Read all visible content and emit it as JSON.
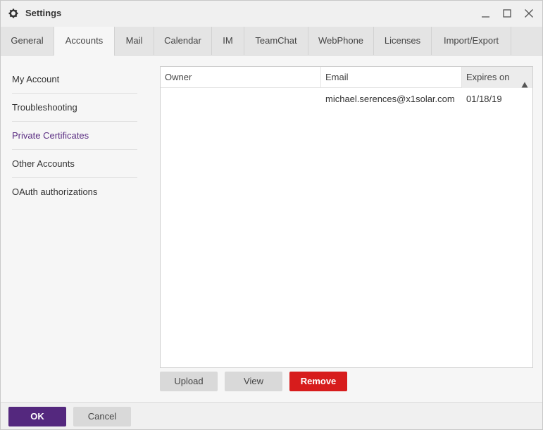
{
  "window": {
    "title": "Settings",
    "icons": {
      "app": "gear-icon",
      "minimize": "minimize-icon",
      "maximize": "maximize-icon",
      "close": "close-icon"
    }
  },
  "tabs": [
    {
      "label": "General"
    },
    {
      "label": "Accounts",
      "active": true
    },
    {
      "label": "Mail"
    },
    {
      "label": "Calendar"
    },
    {
      "label": "IM"
    },
    {
      "label": "TeamChat"
    },
    {
      "label": "WebPhone"
    },
    {
      "label": "Licenses"
    },
    {
      "label": "Import/Export"
    }
  ],
  "sidebar": {
    "items": [
      {
        "label": "My Account"
      },
      {
        "label": "Troubleshooting"
      },
      {
        "label": "Private Certificates",
        "active": true
      },
      {
        "label": "Other Accounts"
      },
      {
        "label": "OAuth authorizations"
      }
    ]
  },
  "grid": {
    "columns": [
      {
        "label": "Owner"
      },
      {
        "label": "Email"
      },
      {
        "label": "Expires on",
        "sorted": "ascending"
      }
    ],
    "rows": [
      {
        "owner": "",
        "email": "michael.serences@x1solar.com",
        "expires": "01/18/19"
      }
    ]
  },
  "actions": {
    "upload": "Upload",
    "view": "View",
    "remove": "Remove"
  },
  "footer": {
    "ok": "OK",
    "cancel": "Cancel"
  },
  "colors": {
    "accent": "#54287e",
    "danger": "#d71c1c",
    "active_link": "#5a2d82"
  }
}
